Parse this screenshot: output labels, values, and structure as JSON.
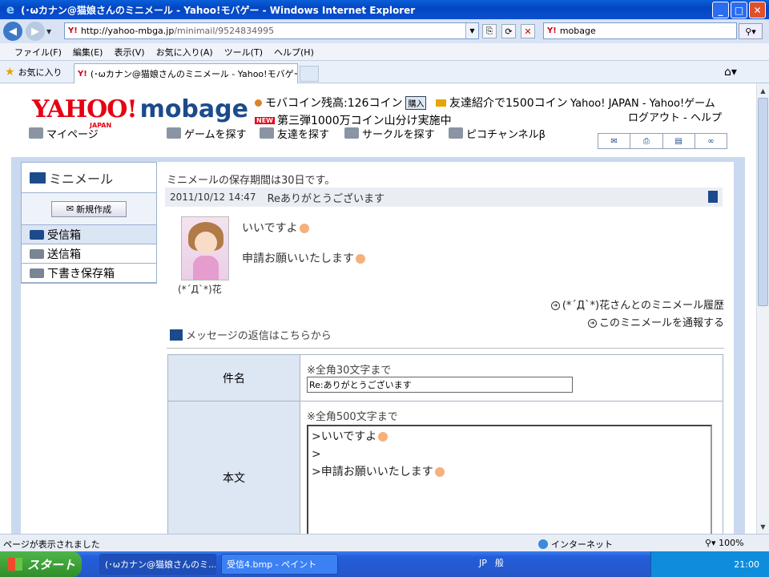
{
  "window": {
    "title": "(･ωカナン@猫娘さんのミニメール - Yahoo!モバゲー - Windows Internet Explorer"
  },
  "addressbar": {
    "url_host": "http://yahoo-mbga.jp",
    "url_path": "/minimail/9524834995",
    "search_value": "mobage"
  },
  "menu": [
    "ファイル(F)",
    "編集(E)",
    "表示(V)",
    "お気に入り(A)",
    "ツール(T)",
    "ヘルプ(H)"
  ],
  "favorites": {
    "label": "お気に入り",
    "tab_title": "(･ωカナン@猫娘さんのミニメール - Yahoo!モバゲー"
  },
  "header": {
    "logo_yahoo": "YAHOO!",
    "logo_japan": "JAPAN",
    "logo_mobage": "mobage",
    "coin_text": "モバコイン残高:126コイン",
    "buy_label": "購入",
    "invite_text": "友達紹介で1500コイン",
    "yj_link": "Yahoo! JAPAN - Yahoo!ゲーム",
    "new_badge": "NEW",
    "campaign_text": "第三弾1000万コイン山分け実施中",
    "logout_help": "ログアウト - ヘルプ"
  },
  "gnav": {
    "mypage": "マイページ",
    "find_game": "ゲームを探す",
    "find_friend": "友達を探す",
    "find_circle": "サークルを探す",
    "pico": "ピコチャンネルβ"
  },
  "sidebar": {
    "title": "ミニメール",
    "new_button": "新規作成",
    "items": [
      "受信箱",
      "送信箱",
      "下書き保存箱"
    ]
  },
  "message": {
    "notice": "ミニメールの保存期間は30日です。",
    "date": "2011/10/12 14:47",
    "subject": "Reありがとうございます",
    "line1": "いいですよ",
    "line2": "申請お願いいたします",
    "sender": "(*´Д`*)花",
    "history_link": "(*´Д`*)花さんとのミニメール履歴",
    "report_link": "このミニメールを通報する",
    "reply_heading": "メッセージの返信はこちらから"
  },
  "form": {
    "subject_label": "件名",
    "subject_hint": "※全角30文字まで",
    "subject_value": "Re:ありがとうございます",
    "body_label": "本文",
    "body_hint": "※全角500文字まで",
    "body_line1": ">いいですよ",
    "body_line2": ">",
    "body_line3": ">申請お願いいたします"
  },
  "status": {
    "message": "ページが表示されました",
    "zone": "インターネット",
    "zoom": "100%"
  },
  "taskbar": {
    "start": "スタート",
    "task1": "(･ωカナン@猫娘さんのミ...",
    "task2": "受信4.bmp - ペイント",
    "ime_lang": "JP",
    "ime_mode": "般",
    "clock": "21:00"
  },
  "colors": {
    "titlebar": "#0346c4",
    "yahoo_red": "#e60012",
    "mobage_blue": "#1c4b8c",
    "frame_blue": "#c9d9ef"
  }
}
